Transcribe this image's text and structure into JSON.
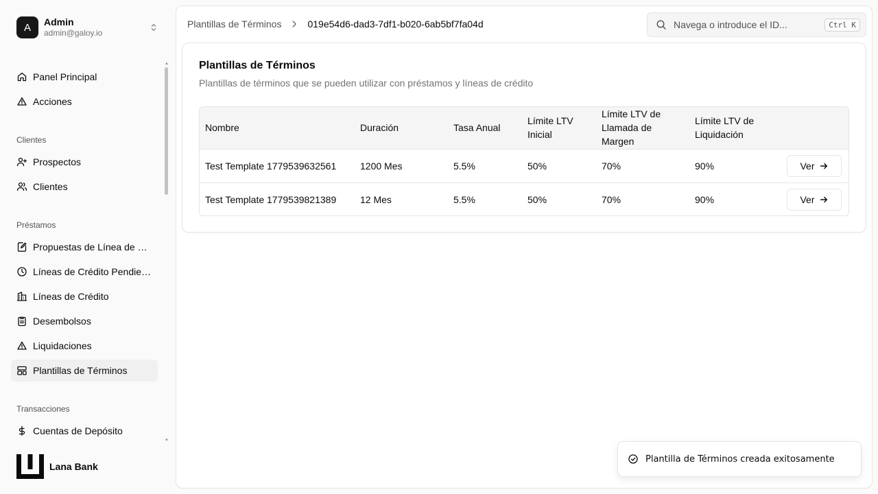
{
  "user": {
    "initial": "A",
    "name": "Admin",
    "email": "admin@galoy.io"
  },
  "nav": {
    "top": [
      {
        "label": "Panel Principal",
        "icon": "home-icon"
      },
      {
        "label": "Acciones",
        "icon": "alert-triangle-icon"
      }
    ],
    "clientes_label": "Clientes",
    "clientes": [
      {
        "label": "Prospectos",
        "icon": "user-plus-icon"
      },
      {
        "label": "Clientes",
        "icon": "users-icon"
      }
    ],
    "prestamos_label": "Préstamos",
    "prestamos": [
      {
        "label": "Propuestas de Línea de Cr...",
        "icon": "file-edit-icon"
      },
      {
        "label": "Líneas de Crédito Pendient...",
        "icon": "clock-icon"
      },
      {
        "label": "Líneas de Crédito",
        "icon": "building-icon"
      },
      {
        "label": "Desembolsos",
        "icon": "clipboard-icon"
      },
      {
        "label": "Liquidaciones",
        "icon": "alert-triangle-icon"
      },
      {
        "label": "Plantillas de Términos",
        "icon": "layout-template-icon"
      }
    ],
    "transacciones_label": "Transacciones",
    "transacciones": [
      {
        "label": "Cuentas de Depósito",
        "icon": "dollar-icon"
      }
    ]
  },
  "brand": {
    "name": "Lana Bank"
  },
  "breadcrumb": {
    "parent": "Plantillas de Términos",
    "current": "019e54d6-dad3-7df1-b020-6ab5bf7fa04d"
  },
  "search": {
    "placeholder": "Navega o introduce el ID...",
    "shortcut": "Ctrl K"
  },
  "card": {
    "title": "Plantillas de Términos",
    "description": "Plantillas de términos que se pueden utilizar con préstamos y líneas de crédito"
  },
  "table": {
    "headers": {
      "name": "Nombre",
      "duration": "Duración",
      "rate": "Tasa Anual",
      "initial_ltv": "Límite LTV Inicial",
      "margin_ltv": "Límite LTV de Llamada de Margen",
      "liquidation_ltv": "Límite LTV de Liquidación"
    },
    "rows": [
      {
        "name": "Test Template 1779539632561",
        "duration": "1200 Mes",
        "rate": "5.5%",
        "initial_ltv": "50%",
        "margin_ltv": "70%",
        "liquidation_ltv": "90%",
        "action": "Ver"
      },
      {
        "name": "Test Template 1779539821389",
        "duration": "12 Mes",
        "rate": "5.5%",
        "initial_ltv": "50%",
        "margin_ltv": "70%",
        "liquidation_ltv": "90%",
        "action": "Ver"
      }
    ]
  },
  "toast": {
    "message": "Plantilla de Términos creada exitosamente"
  }
}
